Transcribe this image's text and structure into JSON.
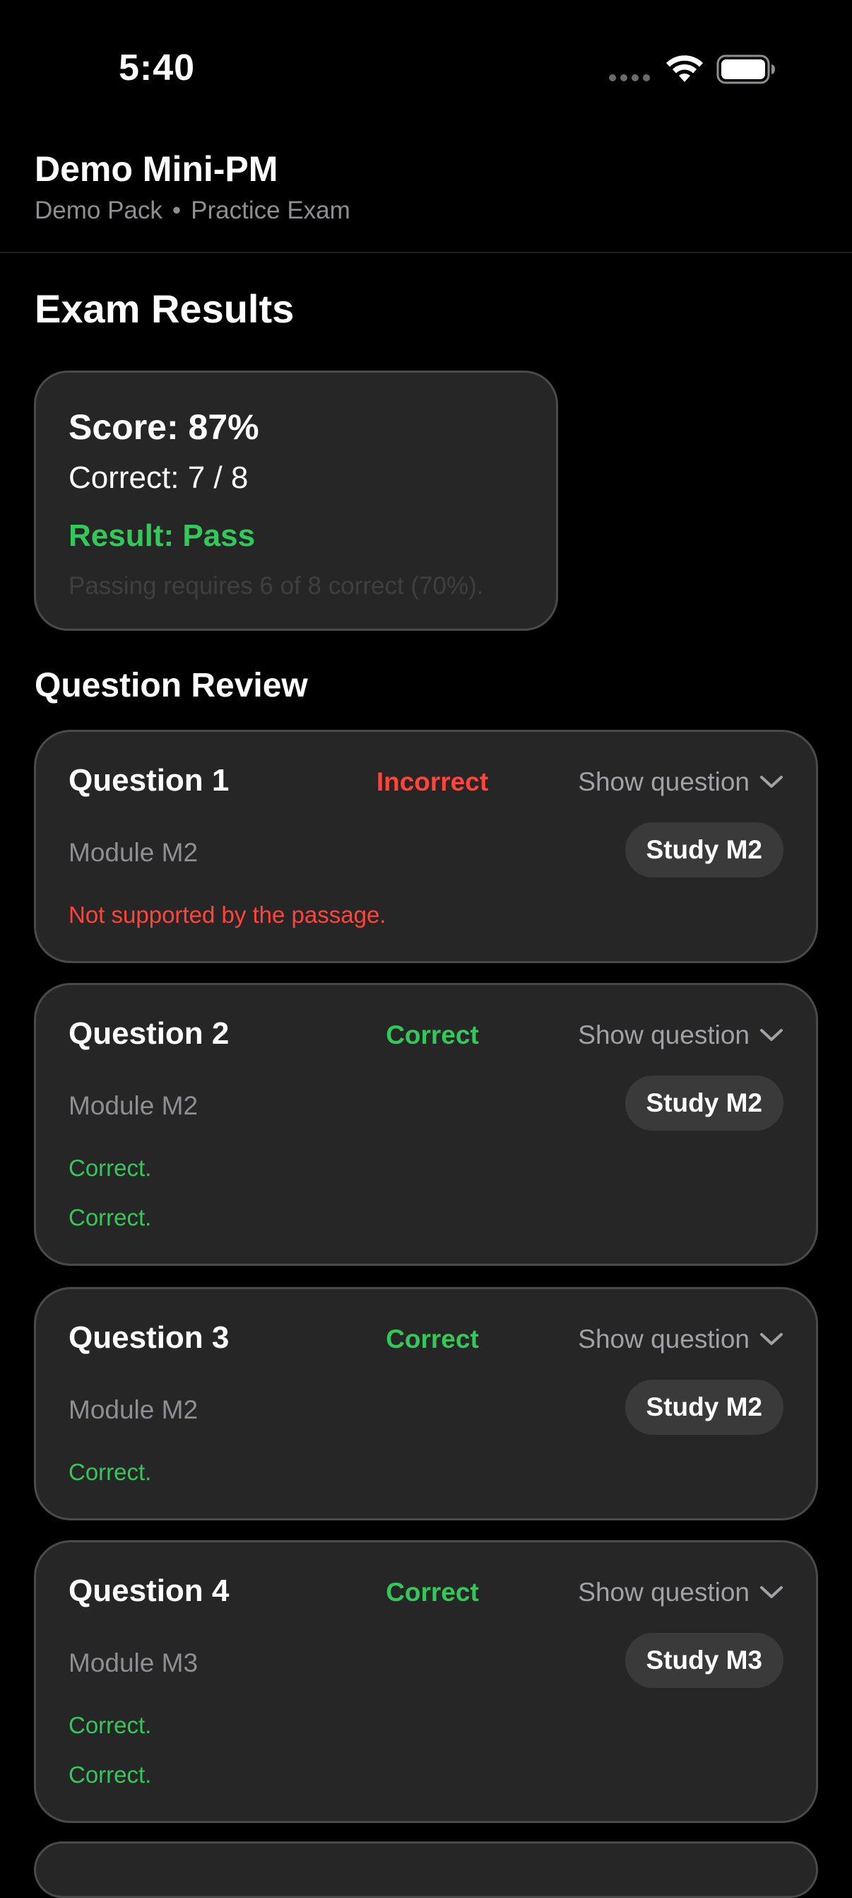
{
  "status_bar": {
    "time": "5:40"
  },
  "header": {
    "title": "Demo Mini-PM",
    "subtitle_pack": "Demo Pack",
    "subtitle_separator": "•",
    "subtitle_mode": "Practice Exam"
  },
  "results": {
    "heading": "Exam Results",
    "score": "Score: 87%",
    "correct": "Correct: 7 / 8",
    "result": "Result: Pass",
    "passing_note": "Passing requires 6 of 8 correct (70%)."
  },
  "review": {
    "heading": "Question Review",
    "toggle_label": "Show question",
    "questions": [
      {
        "title": "Question 1",
        "status": "Incorrect",
        "module": "Module M2",
        "study_label": "Study M2",
        "feedback": [
          "Not supported by the passage."
        ]
      },
      {
        "title": "Question 2",
        "status": "Correct",
        "module": "Module M2",
        "study_label": "Study M2",
        "feedback": [
          "Correct.",
          "Correct."
        ]
      },
      {
        "title": "Question 3",
        "status": "Correct",
        "module": "Module M2",
        "study_label": "Study M2",
        "feedback": [
          "Correct."
        ]
      },
      {
        "title": "Question 4",
        "status": "Correct",
        "module": "Module M3",
        "study_label": "Study M3",
        "feedback": [
          "Correct.",
          "Correct."
        ]
      }
    ]
  },
  "colors": {
    "background": "#000000",
    "card": "#262626",
    "card_border": "#4a4a4a",
    "correct": "#34c759",
    "incorrect": "#ff453a",
    "muted": "#8e8e93"
  },
  "icons": {
    "wifi": "wifi-icon",
    "battery": "battery-icon",
    "signal": "signal-dots-icon",
    "chevron": "chevron-down-icon"
  }
}
